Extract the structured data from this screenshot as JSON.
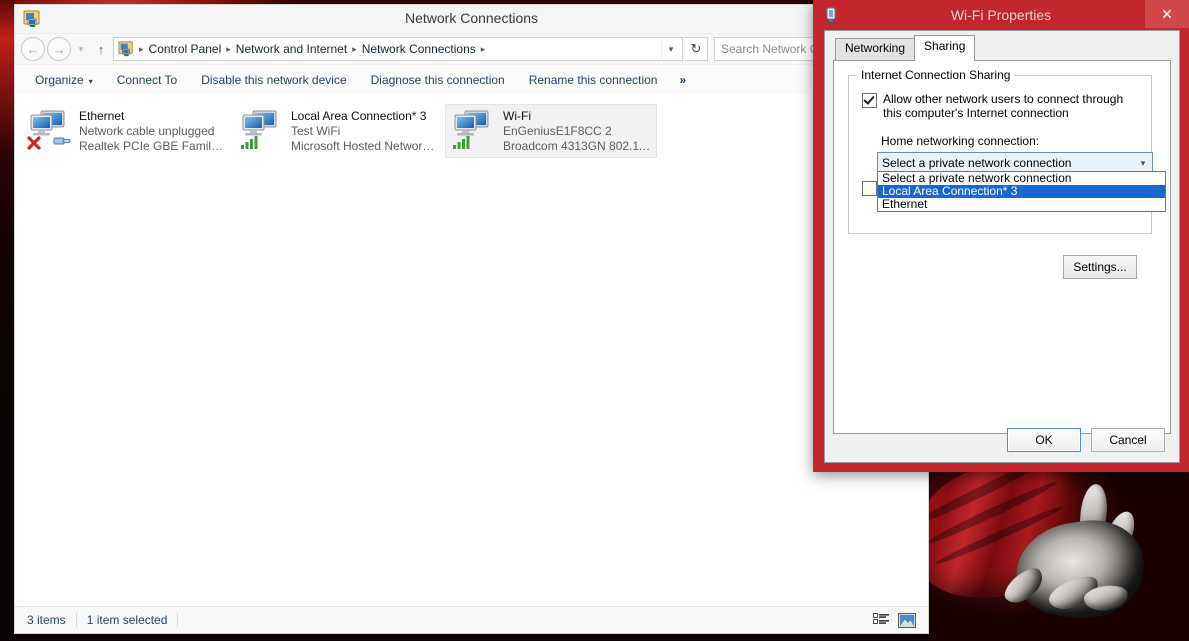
{
  "explorer": {
    "title": "Network Connections",
    "title_icon": "network-adapter-icon",
    "nav": {
      "back": "back-arrow-icon",
      "forward": "forward-arrow-icon",
      "history": "history-dropdown-icon",
      "up": "up-arrow-icon"
    },
    "breadcrumb": {
      "icon": "network-adapter-icon",
      "items": [
        "Control Panel",
        "Network and Internet",
        "Network Connections"
      ],
      "separator": "▸",
      "dropdown_icon": "chevron-down-icon"
    },
    "refresh_icon": "refresh-icon",
    "search": {
      "placeholder": "Search Network C"
    },
    "commands": [
      {
        "label": "Organize",
        "has_caret": true
      },
      {
        "label": "Connect To",
        "has_caret": false
      },
      {
        "label": "Disable this network device",
        "has_caret": false
      },
      {
        "label": "Diagnose this connection",
        "has_caret": false
      },
      {
        "label": "Rename this connection",
        "has_caret": false
      }
    ],
    "overflow_label": "»",
    "view_icons": [
      "details-view-icon",
      "large-icons-view-icon"
    ],
    "connections": [
      {
        "name": "Ethernet",
        "status": "Network cable unplugged",
        "device": "Realtek PCIe GBE Family Controller",
        "icon": "network-adapter-disconnected-icon",
        "selected": false
      },
      {
        "name": "Local Area Connection* 3",
        "status": "Test WiFi",
        "device": "Microsoft Hosted Network Virtual...",
        "icon": "network-adapter-wireless-icon",
        "selected": false
      },
      {
        "name": "Wi-Fi",
        "status": "EnGeniusE1F8CC  2",
        "device": "Broadcom 4313GN 802.11b/g/n 1...",
        "icon": "network-adapter-wireless-icon",
        "selected": true
      }
    ],
    "status_bar": {
      "item_count": "3 items",
      "selection": "1 item selected"
    }
  },
  "dialog": {
    "title": "Wi-Fi Properties",
    "title_icon": "network-adapter-icon",
    "close_label": "✕",
    "tabs": [
      {
        "label": "Networking",
        "active": false
      },
      {
        "label": "Sharing",
        "active": true
      }
    ],
    "group_title": "Internet Connection Sharing",
    "allow_checkbox": {
      "label": "Allow other network users to connect through this computer's Internet connection",
      "checked": true
    },
    "home_network_label": "Home networking connection:",
    "combo": {
      "value": "Select a private network connection",
      "arrow_icon": "chevron-down-icon",
      "open": true,
      "options": [
        {
          "label": "Select a private network connection",
          "selected": false
        },
        {
          "label": "Local Area Connection* 3",
          "selected": true
        },
        {
          "label": "Ethernet",
          "selected": false
        }
      ]
    },
    "second_checkbox": {
      "checked": false
    },
    "settings_button": "Settings...",
    "buttons": [
      {
        "label": "OK",
        "default": true
      },
      {
        "label": "Cancel",
        "default": false
      }
    ],
    "colors": {
      "title_bar": "#c1272d",
      "highlight": "#1669d1",
      "close_hover": "#d1484a"
    }
  },
  "desktop": {
    "wallpaper_description": "dark red wallpaper with outstretched hand in red sleeve"
  }
}
